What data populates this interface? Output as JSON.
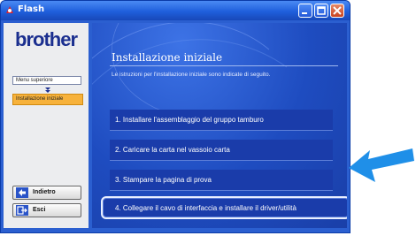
{
  "window": {
    "title": "Flash"
  },
  "sidebar": {
    "logo": "brother",
    "menu_top": "Menu superiore",
    "menu_active": "Installazione iniziale",
    "back_button": "Indietro",
    "exit_button": "Esci"
  },
  "main": {
    "heading": "Installazione iniziale",
    "subtitle": "Le istruzioni per l'installazione iniziale sono indicate di seguito.",
    "steps": [
      {
        "label": "1. Installare l'assemblaggio del gruppo tamburo"
      },
      {
        "label": "2. Caricare la carta nel vassoio carta"
      },
      {
        "label": "3. Stampare la pagina di prova"
      },
      {
        "label": "4. Collegare il cavo di interfaccia e installare il driver/utilità"
      }
    ]
  },
  "colors": {
    "accent": "#2b5fd0",
    "highlight": "#f7b23b",
    "pointer_arrow": "#1f8fe8"
  },
  "icons": [
    "flash-app-icon",
    "minimize-icon",
    "maximize-icon",
    "close-icon",
    "down-arrow-icon",
    "back-arrow-icon",
    "exit-icon",
    "pointer-arrow-icon"
  ]
}
